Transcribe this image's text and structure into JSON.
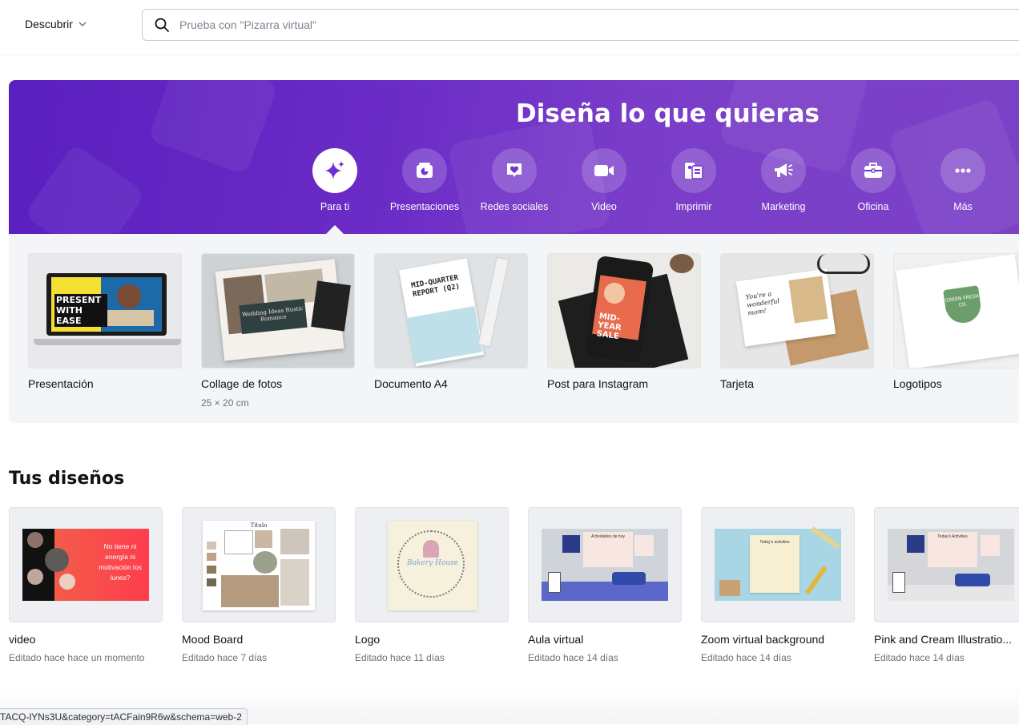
{
  "topbar": {
    "discover_label": "Descubrir",
    "search_placeholder": "Prueba con \"Pizarra virtual\""
  },
  "hero": {
    "title": "Diseña lo que quieras",
    "categories": [
      {
        "label": "Para ti",
        "icon": "sparkle-icon",
        "active": true
      },
      {
        "label": "Presentaciones",
        "icon": "presentation-icon"
      },
      {
        "label": "Redes sociales",
        "icon": "heart-icon"
      },
      {
        "label": "Video",
        "icon": "video-camera-icon"
      },
      {
        "label": "Imprimir",
        "icon": "print-icon"
      },
      {
        "label": "Marketing",
        "icon": "megaphone-icon"
      },
      {
        "label": "Oficina",
        "icon": "briefcase-icon"
      },
      {
        "label": "Más",
        "icon": "more-icon"
      }
    ]
  },
  "templates": [
    {
      "title": "Presentación",
      "subtitle": "",
      "thumb_text": "PRESENT WITH EASE"
    },
    {
      "title": "Collage de fotos",
      "subtitle": "25 × 20 cm",
      "thumb_text": "Wedding Ideas Rustic Romance"
    },
    {
      "title": "Documento A4",
      "subtitle": "",
      "thumb_text": "MID-QUARTER REPORT (Q2)"
    },
    {
      "title": "Post para Instagram",
      "subtitle": "",
      "thumb_text": "MID-YEAR SALE"
    },
    {
      "title": "Tarjeta",
      "subtitle": "",
      "thumb_text": "You're a wonderful mom!"
    },
    {
      "title": "Logotipos",
      "subtitle": "",
      "thumb_text": "GREEN FRESH CO."
    }
  ],
  "designs_section": {
    "title": "Tus diseños",
    "items": [
      {
        "title": "video",
        "subtitle": "Editado hace hace un momento",
        "thumb_text": "No tiene ni energía ni motivación los lunes?"
      },
      {
        "title": "Mood Board",
        "subtitle": "Editado hace 7 días",
        "thumb_text": "Título"
      },
      {
        "title": "Logo",
        "subtitle": "Editado hace 11 días",
        "thumb_text": "Bakery House"
      },
      {
        "title": "Aula virtual",
        "subtitle": "Editado hace 14 días",
        "thumb_text": "Actividades de hoy"
      },
      {
        "title": "Zoom virtual background",
        "subtitle": "Editado hace 14 días",
        "thumb_text": "Today's activities"
      },
      {
        "title": "Pink and Cream Illustratio...",
        "subtitle": "Editado hace 14 días",
        "thumb_text": "Today's Activities"
      }
    ]
  },
  "status_url": "TACQ-lYNs3U&category=tACFain9R6w&schema=web-2",
  "colors": {
    "accent": "#7d2ae8",
    "hero_start": "#5a1fbf",
    "hero_end": "#7c42c6"
  }
}
